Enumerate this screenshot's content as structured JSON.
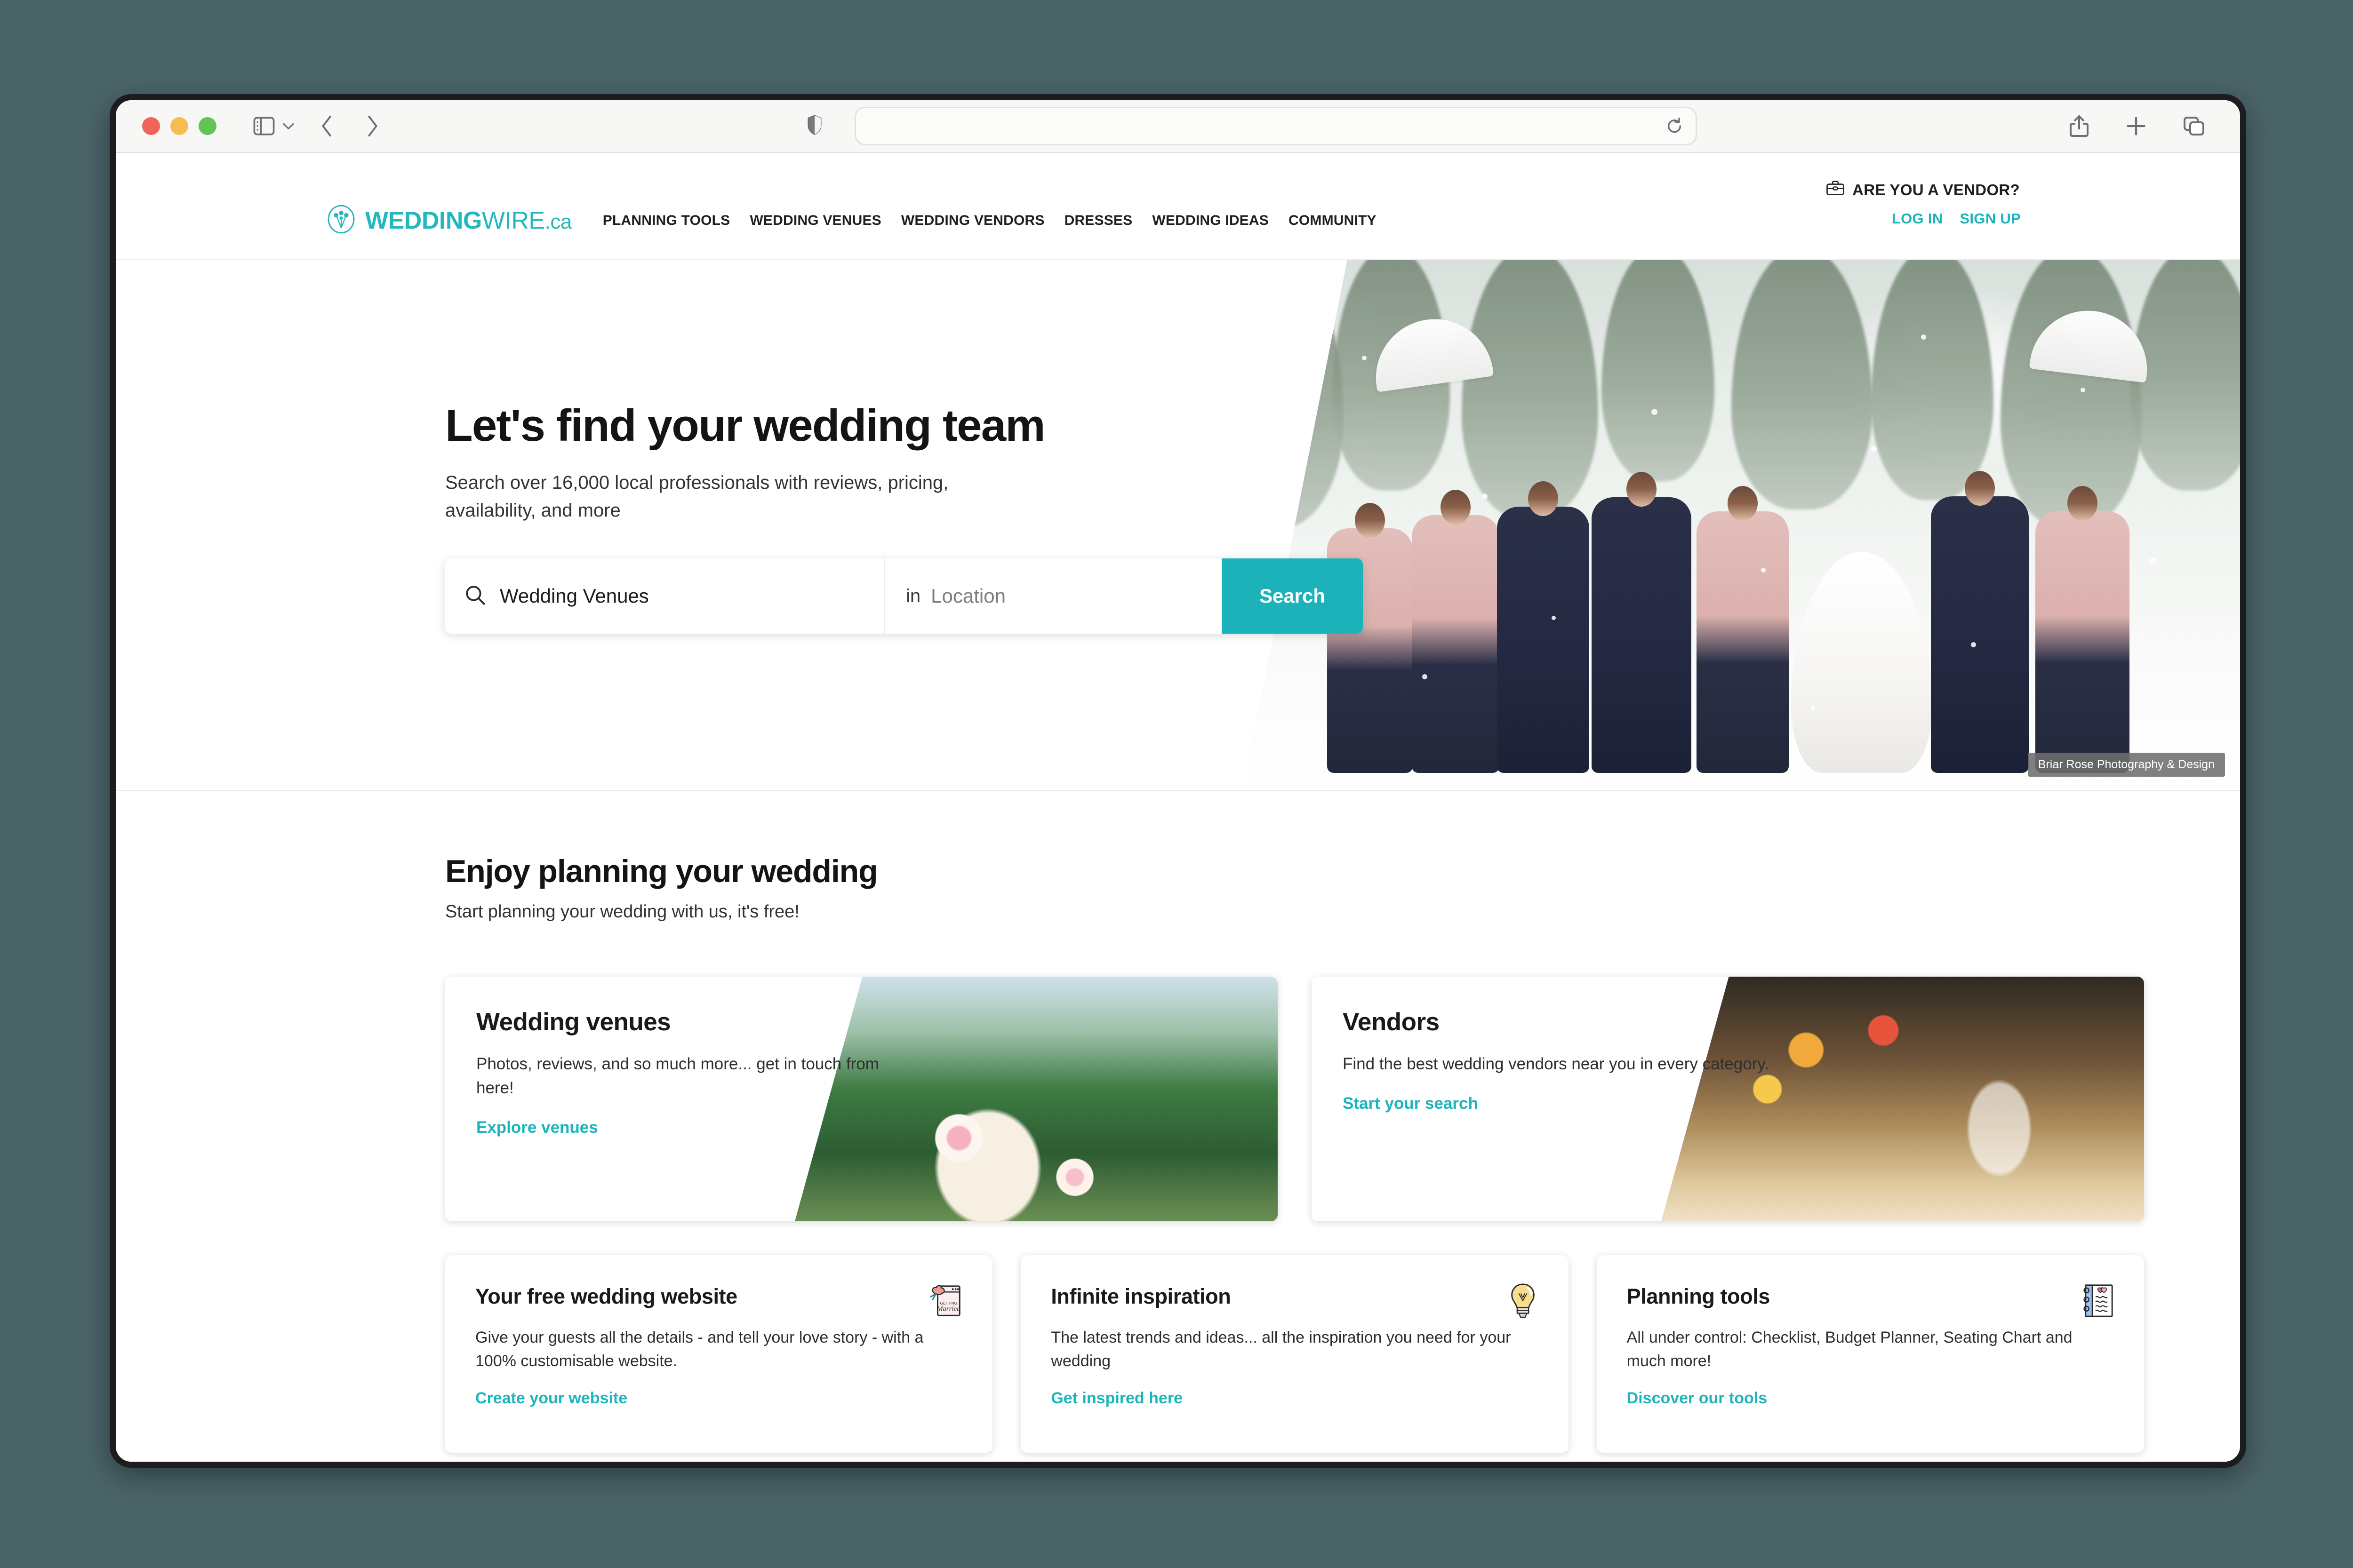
{
  "browser": {
    "url_value": "",
    "url_placeholder": "",
    "traffic_lights": [
      "close",
      "minimize",
      "zoom"
    ],
    "toolbar_icons": [
      "sidebar-icon",
      "chevron-down-icon",
      "back-icon",
      "forward-icon",
      "shield-icon",
      "reload-icon",
      "share-icon",
      "new-tab-icon",
      "tab-overview-icon"
    ]
  },
  "site_header": {
    "vendor_prompt": "ARE YOU A VENDOR?",
    "logo": {
      "bold": "WEDDING",
      "light": "WIRE",
      "tld": ".ca"
    },
    "nav": [
      {
        "label": "PLANNING TOOLS"
      },
      {
        "label": "WEDDING VENUES"
      },
      {
        "label": "WEDDING VENDORS"
      },
      {
        "label": "DRESSES"
      },
      {
        "label": "WEDDING IDEAS"
      },
      {
        "label": "COMMUNITY"
      }
    ],
    "auth": [
      {
        "label": "LOG IN"
      },
      {
        "label": "SIGN UP"
      }
    ]
  },
  "hero": {
    "title": "Let's find your wedding team",
    "subtitle": "Search over 16,000 local professionals with reviews, pricing, availability, and more",
    "search": {
      "what_value": "Wedding Venues",
      "in_label": "in",
      "where_placeholder": "Location",
      "button_label": "Search"
    },
    "photo_credit": "Briar Rose Photography & Design"
  },
  "planning": {
    "title": "Enjoy planning your wedding",
    "subtitle": "Start planning your wedding with us, it's free!",
    "big_cards": [
      {
        "title": "Wedding venues",
        "desc": "Photos, reviews, and so much more... get in touch from here!",
        "link": "Explore venues"
      },
      {
        "title": "Vendors",
        "desc": "Find the best wedding vendors near you in every category.",
        "link": "Start your search"
      }
    ],
    "small_cards": [
      {
        "title": "Your free wedding website",
        "desc": "Give your guests all the details - and tell your love story - with a 100% customisable website.",
        "link": "Create your website",
        "icon": "wedding-invitation-icon"
      },
      {
        "title": "Infinite inspiration",
        "desc": "The latest trends and ideas... all the inspiration you need for your wedding",
        "link": "Get inspired here",
        "icon": "lightbulb-icon"
      },
      {
        "title": "Planning tools",
        "desc": "All under control: Checklist, Budget Planner, Seating Chart and much more!",
        "link": "Discover our tools",
        "icon": "notebook-icon"
      }
    ]
  },
  "colors": {
    "brand_teal": "#1db4bb",
    "search_button": "#1cb2b9",
    "text_dark": "#141414",
    "page_background": "#4a6468"
  }
}
